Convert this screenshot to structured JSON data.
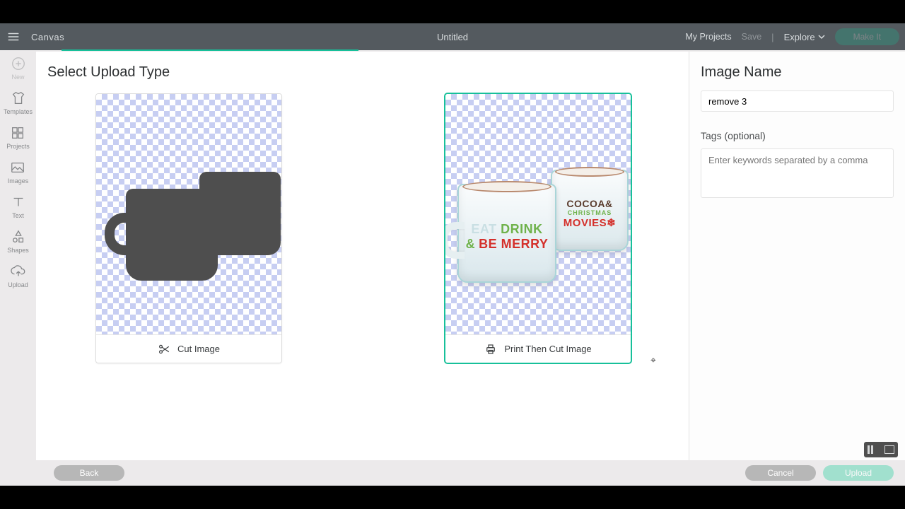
{
  "topbar": {
    "brand": "Canvas",
    "title": "Untitled",
    "my_projects": "My Projects",
    "save": "Save",
    "explore": "Explore",
    "make_it": "Make It"
  },
  "tools": {
    "new": "New",
    "templates": "Templates",
    "projects": "Projects",
    "images": "Images",
    "text": "Text",
    "shapes": "Shapes",
    "upload": "Upload"
  },
  "main": {
    "heading": "Select Upload Type",
    "cut_label": "Cut Image",
    "print_label": "Print Then Cut Image",
    "mugA": {
      "l1a": "EAT",
      "l1b": "DRINK",
      "l2a": "&",
      "l2b": "BE MERRY"
    },
    "mugB": {
      "l1": "COCOA&",
      "l2": "CHRISTMAS",
      "l3": "MOVIES❄"
    }
  },
  "side": {
    "heading": "Image Name",
    "name_value": "remove 3",
    "tags_label": "Tags (optional)",
    "tags_placeholder": "Enter keywords separated by a comma"
  },
  "bottom": {
    "back": "Back",
    "cancel": "Cancel",
    "upload": "Upload"
  }
}
